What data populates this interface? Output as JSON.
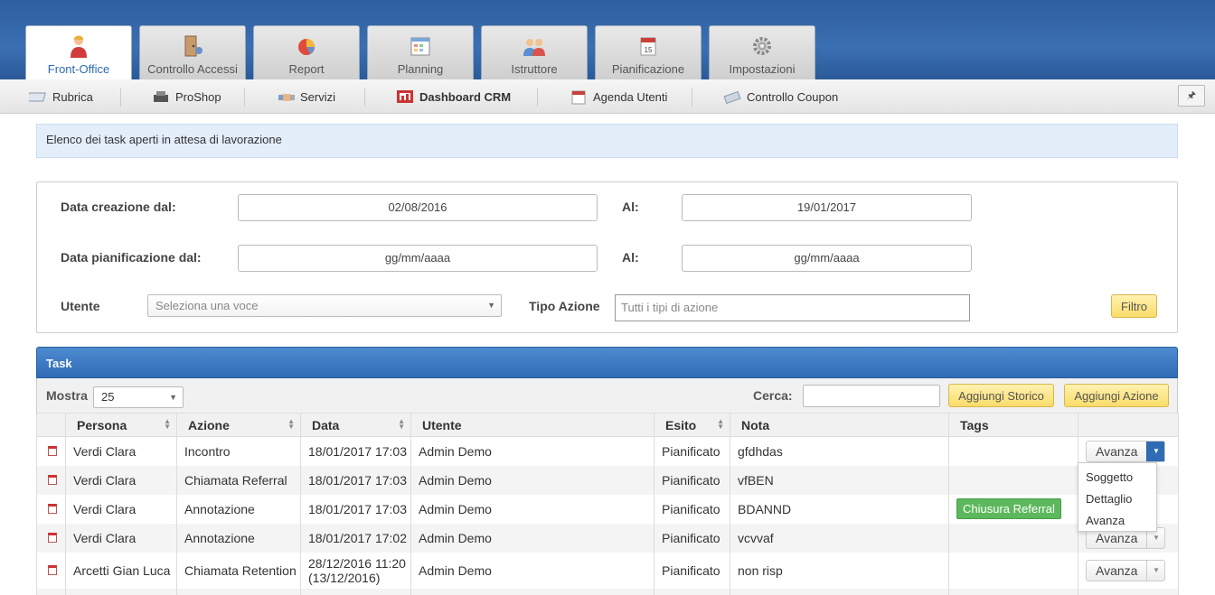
{
  "tabs": [
    {
      "label": "Front-Office",
      "icon": "user-icon",
      "active": true
    },
    {
      "label": "Controllo Accessi",
      "icon": "door-icon",
      "active": false
    },
    {
      "label": "Report",
      "icon": "pie-chart-icon",
      "active": false
    },
    {
      "label": "Planning",
      "icon": "calendar-grid-icon",
      "active": false
    },
    {
      "label": "Istruttore",
      "icon": "people-icon",
      "active": false
    },
    {
      "label": "Pianificazione",
      "icon": "calendar-icon",
      "active": false
    },
    {
      "label": "Impostazioni",
      "icon": "gear-icon",
      "active": false
    }
  ],
  "subnav": [
    {
      "label": "Rubrica",
      "icon": "address-book-icon"
    },
    {
      "label": "ProShop",
      "icon": "cash-register-icon"
    },
    {
      "label": "Servizi",
      "icon": "handshake-icon"
    },
    {
      "label": "Dashboard CRM",
      "icon": "dashboard-icon"
    },
    {
      "label": "Agenda Utenti",
      "icon": "agenda-icon"
    },
    {
      "label": "Controllo Coupon",
      "icon": "coupon-icon"
    }
  ],
  "info_text": "Elenco dei task aperti in attesa di lavorazione",
  "filters": {
    "creazione_label": "Data creazione dal:",
    "creazione_from": "02/08/2016",
    "al_label": "Al:",
    "creazione_to": "19/01/2017",
    "pianificazione_label": "Data pianificazione dal:",
    "pianificazione_from": "gg/mm/aaaa",
    "pianificazione_to": "gg/mm/aaaa",
    "utente_label": "Utente",
    "utente_placeholder": "Seleziona una voce",
    "tipo_label": "Tipo Azione",
    "tipo_placeholder": "Tutti i tipi di azione",
    "filtro_button": "Filtro"
  },
  "task": {
    "title": "Task",
    "mostra_label": "Mostra",
    "mostra_value": "25",
    "cerca_label": "Cerca:",
    "aggiungi_storico": "Aggiungi Storico",
    "aggiungi_azione": "Aggiungi Azione",
    "columns": [
      "Persona",
      "Azione",
      "Data",
      "Utente",
      "Esito",
      "Nota",
      "Tags"
    ],
    "rows": [
      {
        "persona": "Verdi Clara",
        "azione": "Incontro",
        "data": "18/01/2017 17:03",
        "data2": "",
        "utente": "Admin Demo",
        "esito": "Pianificato",
        "nota": "gfdhdas",
        "tag": ""
      },
      {
        "persona": "Verdi Clara",
        "azione": "Chiamata Referral",
        "data": "18/01/2017 17:03",
        "data2": "",
        "utente": "Admin Demo",
        "esito": "Pianificato",
        "nota": "vfBEN",
        "tag": ""
      },
      {
        "persona": "Verdi Clara",
        "azione": "Annotazione",
        "data": "18/01/2017 17:03",
        "data2": "",
        "utente": "Admin Demo",
        "esito": "Pianificato",
        "nota": "BDANND",
        "tag": "Chiusura Referral"
      },
      {
        "persona": "Verdi Clara",
        "azione": "Annotazione",
        "data": "18/01/2017 17:02",
        "data2": "",
        "utente": "Admin Demo",
        "esito": "Pianificato",
        "nota": "vcvvaf",
        "tag": ""
      },
      {
        "persona": "Arcetti Gian Luca",
        "azione": "Chiamata Retention",
        "data": "28/12/2016 11:20",
        "data2": "(13/12/2016)",
        "utente": "Admin Demo",
        "esito": "Pianificato",
        "nota": "non risp",
        "tag": ""
      }
    ],
    "avanza_label": "Avanza",
    "dropdown_menu": [
      "Soggetto",
      "Dettaglio",
      "Avanza"
    ]
  }
}
